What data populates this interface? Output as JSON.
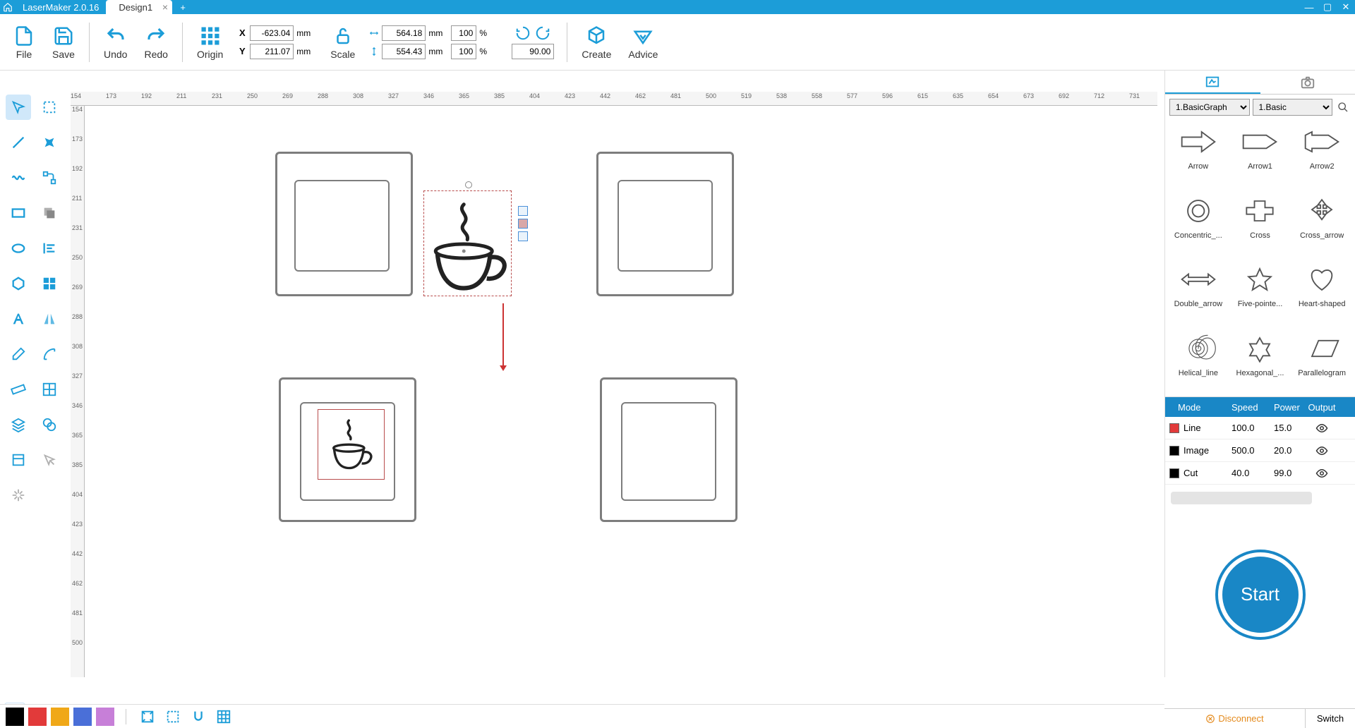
{
  "titlebar": {
    "app_name": "LaserMaker 2.0.16",
    "tab_name": "Design1"
  },
  "toolbar": {
    "file": "File",
    "save": "Save",
    "undo": "Undo",
    "redo": "Redo",
    "origin": "Origin",
    "scale": "Scale",
    "create": "Create",
    "advice": "Advice",
    "x_label": "X",
    "y_label": "Y",
    "x_val": "-623.04",
    "y_val": "211.07",
    "w_val": "564.18",
    "h_val": "554.43",
    "w_pct": "100",
    "h_pct": "100",
    "unit_mm": "mm",
    "unit_pct": "%",
    "rotate_val": "90.00"
  },
  "ruler_h": [
    "154",
    "173",
    "192",
    "211",
    "231",
    "250",
    "269",
    "288",
    "308",
    "327",
    "346",
    "365",
    "385",
    "404",
    "423",
    "442",
    "462",
    "481",
    "500",
    "519",
    "538",
    "558",
    "577",
    "596",
    "615",
    "635",
    "654",
    "673",
    "692",
    "712",
    "731"
  ],
  "ruler_v": [
    "154",
    "173",
    "192",
    "211",
    "231",
    "250",
    "269",
    "288",
    "308",
    "327",
    "346",
    "365",
    "385",
    "404",
    "423",
    "442",
    "462",
    "481",
    "500"
  ],
  "shapes_panel": {
    "filter1": "1.BasicGraph",
    "filter2": "1.Basic",
    "items": [
      {
        "name": "Arrow"
      },
      {
        "name": "Arrow1"
      },
      {
        "name": "Arrow2"
      },
      {
        "name": "Concentric_..."
      },
      {
        "name": "Cross"
      },
      {
        "name": "Cross_arrow"
      },
      {
        "name": "Double_arrow"
      },
      {
        "name": "Five-pointe..."
      },
      {
        "name": "Heart-shaped"
      },
      {
        "name": "Helical_line"
      },
      {
        "name": "Hexagonal_..."
      },
      {
        "name": "Parallelogram"
      }
    ]
  },
  "layers": {
    "headers": {
      "mode": "Mode",
      "speed": "Speed",
      "power": "Power",
      "output": "Output"
    },
    "rows": [
      {
        "color": "#e23a3a",
        "mode": "Line",
        "speed": "100.0",
        "power": "15.0"
      },
      {
        "color": "#000000",
        "mode": "Image",
        "speed": "500.0",
        "power": "20.0"
      },
      {
        "color": "#000000",
        "mode": "Cut",
        "speed": "40.0",
        "power": "99.0"
      }
    ]
  },
  "start_btn": "Start",
  "status": {
    "disconnect": "Disconnect",
    "switch": "Switch"
  },
  "bottom_colors": [
    "#000000",
    "#e23a3a",
    "#f0a818",
    "#4a6fd8",
    "#c77fd8"
  ]
}
